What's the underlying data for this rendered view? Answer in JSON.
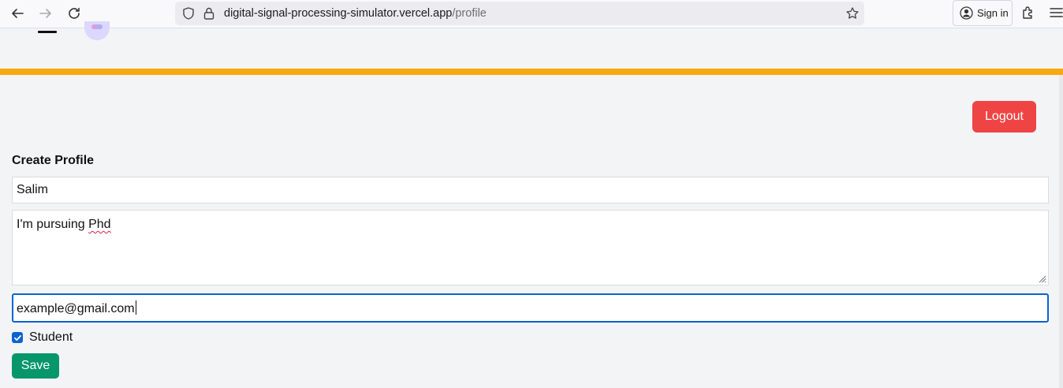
{
  "browser": {
    "url_host": "digital-signal-processing-simulator.vercel.app",
    "url_path": "/profile",
    "signin_label": "Sign in"
  },
  "header": {
    "accent_color": "#f9a80e"
  },
  "profile": {
    "logout_label": "Logout",
    "title": "Create Profile",
    "name_value": "Salim",
    "bio_text_before": "I'm pursuing ",
    "bio_text_misspelled": "Phd",
    "email_value": "example@gmail.com",
    "student_label": "Student",
    "student_checked": true,
    "save_label": "Save"
  },
  "colors": {
    "logout": "#ef4444",
    "save": "#059669",
    "focus": "#0b63d1"
  },
  "icons": [
    "back-icon",
    "forward-icon",
    "reload-icon",
    "shield-icon",
    "lock-icon",
    "bookmark-star-icon",
    "account-icon",
    "extensions-icon",
    "menu-icon",
    "hamburger-menu-icon",
    "app-logo",
    "checkmark-icon",
    "resize-grip-icon"
  ]
}
